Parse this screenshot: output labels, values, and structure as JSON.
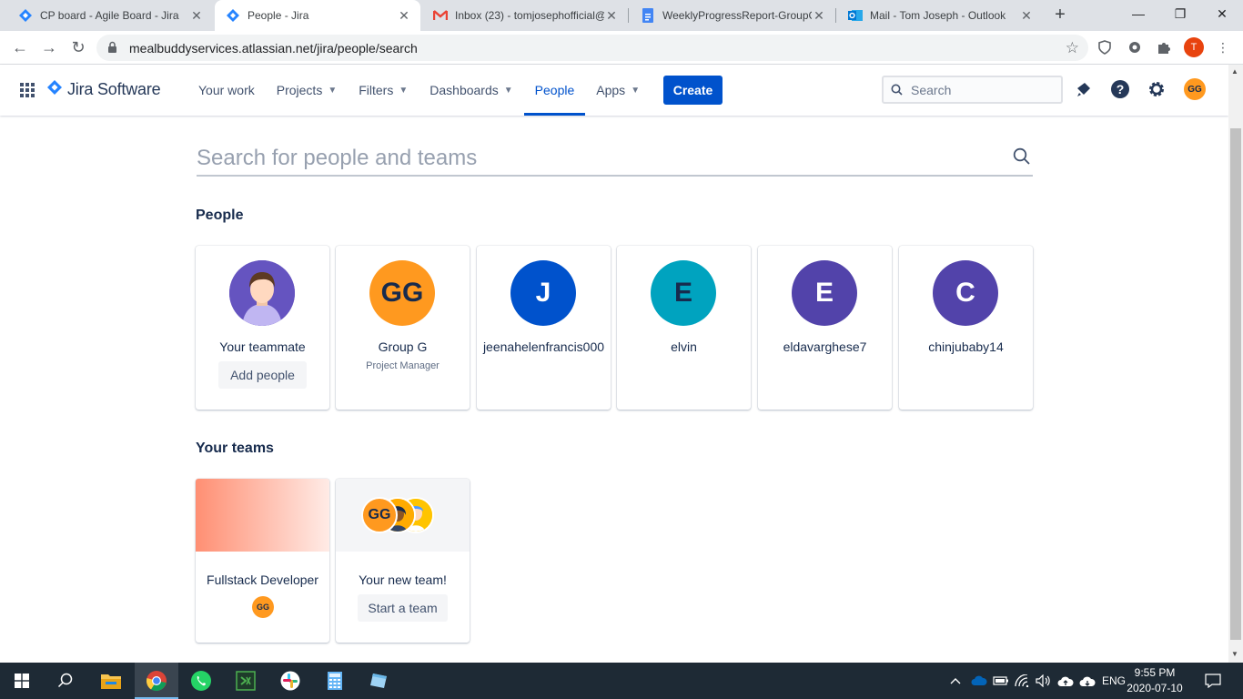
{
  "browser": {
    "tabs": [
      {
        "title": "CP board - Agile Board - Jira",
        "icon": "jira-icon"
      },
      {
        "title": "People - Jira",
        "icon": "jira-icon"
      },
      {
        "title": "Inbox (23) - tomjosephofficial@",
        "icon": "gmail-icon"
      },
      {
        "title": "WeeklyProgressReport-GroupG",
        "icon": "docs-icon"
      },
      {
        "title": "Mail - Tom Joseph - Outlook",
        "icon": "outlook-icon"
      }
    ],
    "url": "mealbuddyservices.atlassian.net/jira/people/search",
    "profile_initial": "T"
  },
  "header": {
    "product": "Jira Software",
    "nav": {
      "your_work": "Your work",
      "projects": "Projects",
      "filters": "Filters",
      "dashboards": "Dashboards",
      "people": "People",
      "apps": "Apps"
    },
    "create": "Create",
    "search_placeholder": "Search",
    "user_initials": "GG"
  },
  "page": {
    "search_placeholder": "Search for people and teams",
    "people_title": "People",
    "teams_title": "Your teams",
    "people": [
      {
        "name": "Your teammate",
        "action": "Add people",
        "avatar": "teammate-illustration",
        "color": "#6554c0"
      },
      {
        "name": "Group G",
        "role": "Project Manager",
        "initials": "GG",
        "color": "#ff991f"
      },
      {
        "name": "jeenahelenfrancis000",
        "initials": "J",
        "color": "#0052cc"
      },
      {
        "name": "elvin",
        "initials": "E",
        "color": "#00a3bf"
      },
      {
        "name": "eldavarghese7",
        "initials": "E",
        "color": "#5243aa"
      },
      {
        "name": "chinjubaby14",
        "initials": "C",
        "color": "#5243aa"
      }
    ],
    "teams": [
      {
        "name": "Fullstack Developer",
        "member_initials": "GG"
      },
      {
        "name": "Your new team!",
        "action": "Start a team",
        "member_initials": "GG"
      }
    ]
  },
  "taskbar": {
    "language": "ENG",
    "time": "9:55 PM",
    "date": "2020-07-10"
  }
}
